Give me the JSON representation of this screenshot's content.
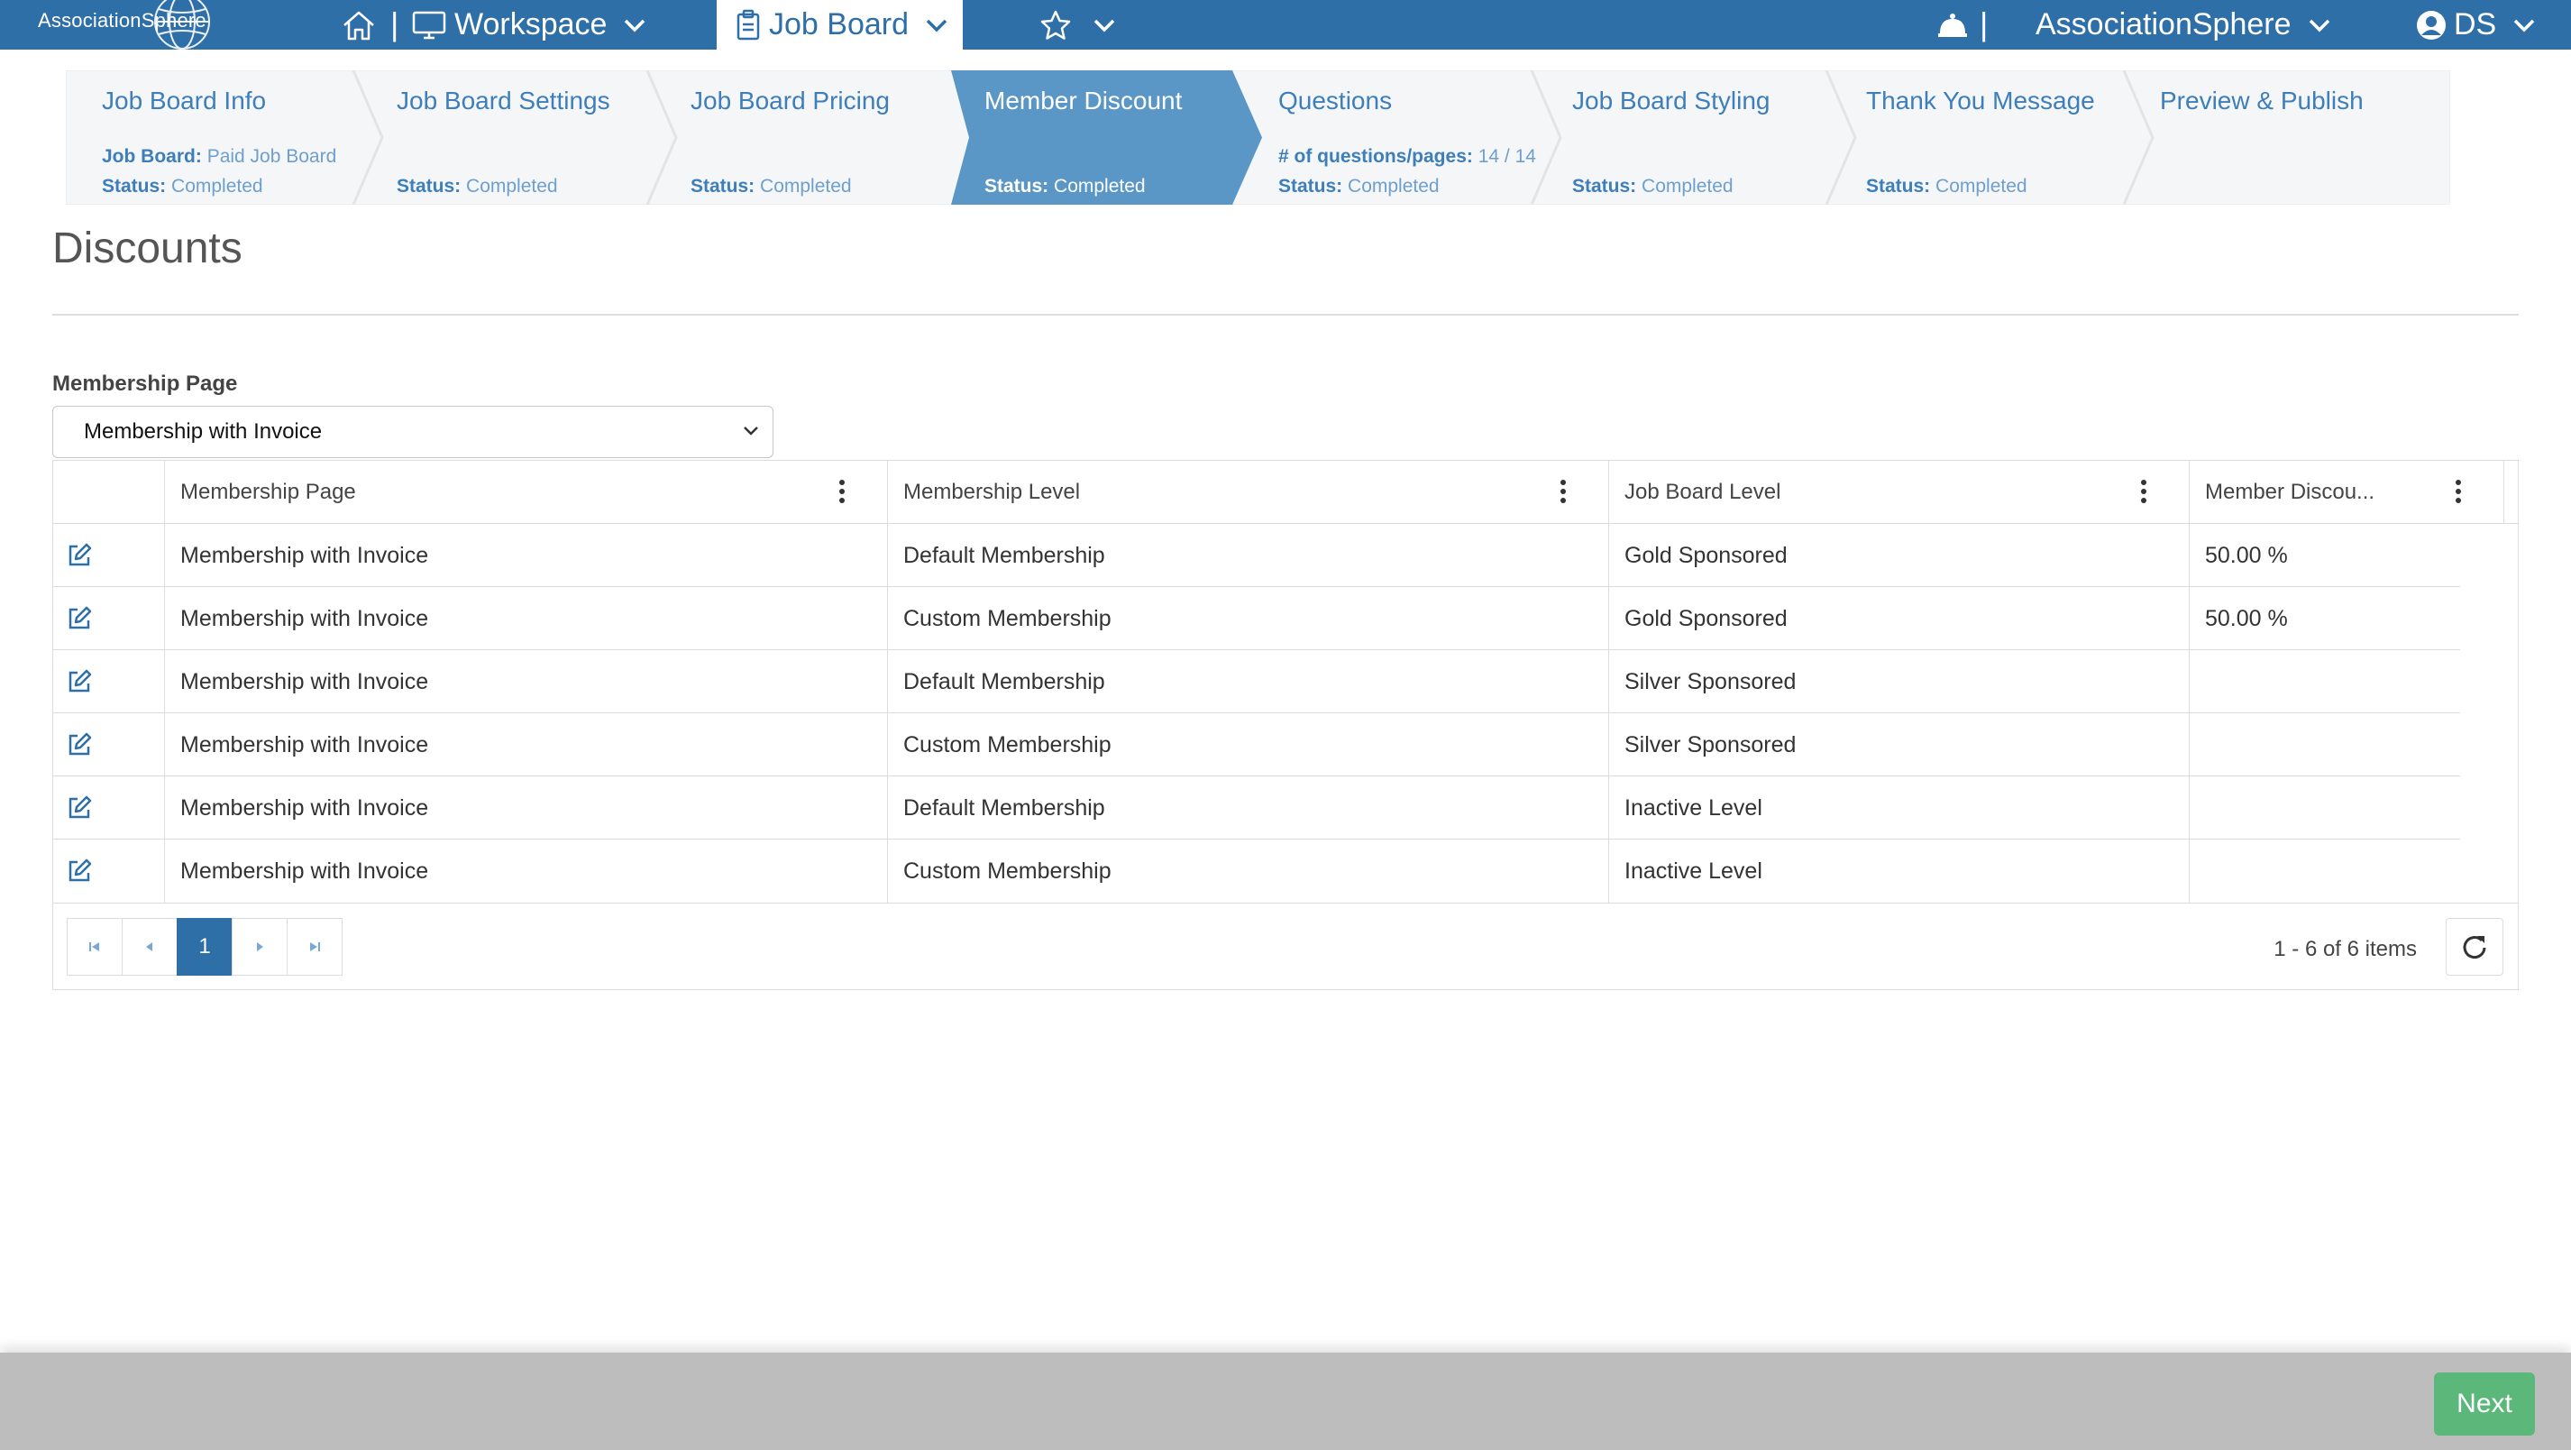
{
  "topnav": {
    "logo_text": "AssociationSphere",
    "workspace_label": "Workspace",
    "job_board_label": "Job Board",
    "org_label": "AssociationSphere",
    "user_initials": "DS",
    "bg_color": "#2f6fa8"
  },
  "steps": [
    {
      "title": "Job Board Info",
      "line1_label": "Job Board:",
      "line1_value": "Paid Job Board",
      "status_label": "Status:",
      "status_value": "Completed"
    },
    {
      "title": "Job Board Settings",
      "status_label": "Status:",
      "status_value": "Completed"
    },
    {
      "title": "Job Board Pricing",
      "status_label": "Status:",
      "status_value": "Completed"
    },
    {
      "title": "Member Discount",
      "status_label": "Status:",
      "status_value": "Completed",
      "active": true
    },
    {
      "title": "Questions",
      "line1_label": "# of questions/pages:",
      "line1_value": "14 / 14",
      "status_label": "Status:",
      "status_value": "Completed"
    },
    {
      "title": "Job Board Styling",
      "status_label": "Status:",
      "status_value": "Completed"
    },
    {
      "title": "Thank You Message",
      "status_label": "Status:",
      "status_value": "Completed"
    },
    {
      "title": "Preview & Publish"
    }
  ],
  "page": {
    "title": "Discounts",
    "field_label": "Membership Page",
    "select_value": "Membership with Invoice"
  },
  "grid": {
    "columns": [
      "Membership Page",
      "Membership Level",
      "Job Board Level",
      "Member Discou..."
    ],
    "rows": [
      [
        "Membership with Invoice",
        "Default Membership",
        "Gold Sponsored",
        "50.00 %"
      ],
      [
        "Membership with Invoice",
        "Custom Membership",
        "Gold Sponsored",
        "50.00 %"
      ],
      [
        "Membership with Invoice",
        "Default Membership",
        "Silver Sponsored",
        ""
      ],
      [
        "Membership with Invoice",
        "Custom Membership",
        "Silver Sponsored",
        ""
      ],
      [
        "Membership with Invoice",
        "Default Membership",
        "Inactive Level",
        ""
      ],
      [
        "Membership with Invoice",
        "Custom Membership",
        "Inactive Level",
        ""
      ]
    ],
    "current_page": "1",
    "items_info": "1 - 6 of 6 items"
  },
  "footer": {
    "next_label": "Next",
    "next_color": "#5cb87a"
  }
}
